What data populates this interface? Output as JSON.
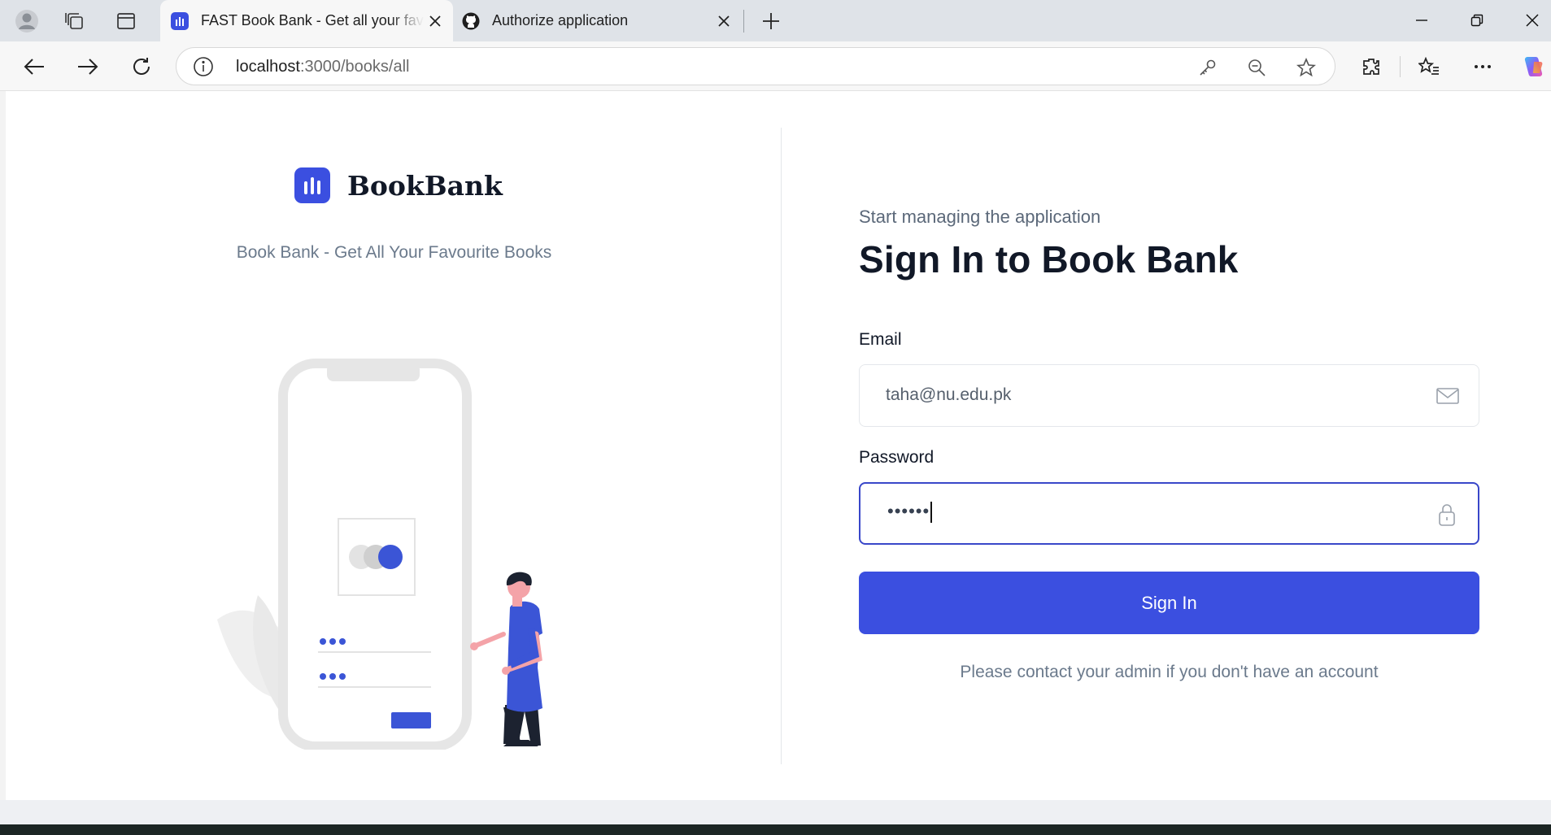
{
  "browser": {
    "tabs": [
      {
        "title": "FAST Book Bank - Get all your favourite books",
        "active": true
      },
      {
        "title": "Authorize application",
        "active": false
      }
    ],
    "url_host": "localhost",
    "url_path": ":3000/books/all"
  },
  "brand": {
    "name": "BookBank",
    "tagline": "Book Bank - Get All Your Favourite Books",
    "color": "#3b4fe0"
  },
  "form": {
    "eyebrow": "Start managing the application",
    "heading": "Sign In to Book Bank",
    "email_label": "Email",
    "email_value": "taha@nu.edu.pk",
    "password_label": "Password",
    "password_value": "••••••",
    "submit_label": "Sign In",
    "note": "Please contact your admin if you don't have an account"
  }
}
